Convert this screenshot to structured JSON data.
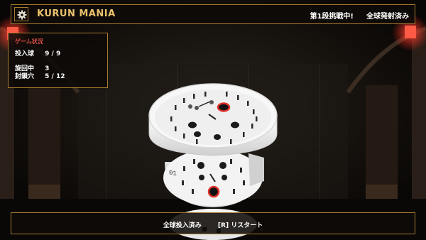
{
  "header": {
    "title": "KURUN MANIA",
    "stage_status": "第1段挑戦中!",
    "fire_status": "全球発射済み",
    "settings_icon": "gear-icon"
  },
  "status_panel": {
    "heading": "ゲーム状況",
    "balls_label": "投入球",
    "balls_value": "9 / 9",
    "spinning_label": "旋回中",
    "spinning_value": "3",
    "sealed_label": "封鎖穴",
    "sealed_value": "5 / 12"
  },
  "board": {
    "tier_label": "01",
    "colors": {
      "accent": "#e1302a",
      "gold": "#a57a2f",
      "board": "#f2f2f2"
    }
  },
  "footer": {
    "message": "全球投入済み",
    "restart_hint": "[R] リスタート"
  }
}
